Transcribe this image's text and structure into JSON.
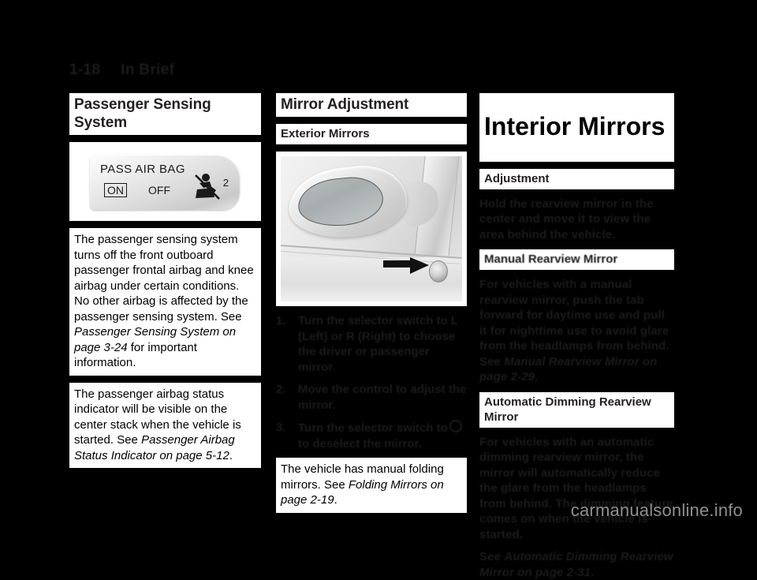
{
  "page": {
    "folio": "1-18",
    "chapter_title": "In Brief",
    "watermark": "carmanualsonline.info"
  },
  "left_column": {
    "section_title": "Passenger Sensing System",
    "figure": {
      "name": "passenger-airbag-status-indicator",
      "label_pass": "PASS AIR BAG",
      "label_on": "ON",
      "label_off": "OFF",
      "badge": "2"
    },
    "paragraph_1": "The passenger sensing system turns off the front outboard passenger frontal airbag and knee airbag under certain conditions. No other airbag is affected by the passenger sensing system. See ",
    "paragraph_1_ref": "Passenger Sensing System on page 3-24",
    "paragraph_1_tail": " for important information.",
    "paragraph_2_lead": "The passenger airbag status indicator will be visible on the center stack when the vehicle is started. See ",
    "paragraph_2_ref": "Passenger Airbag Status Indicator on page 5-12",
    "paragraph_2_tail": "."
  },
  "middle_column": {
    "section_title": "Mirror Adjustment",
    "sub_title": "Exterior Mirrors",
    "figure": {
      "name": "exterior-mirror-control-photo",
      "caption": ""
    },
    "steps": [
      {
        "number": "1.",
        "text": "Turn the selector switch to L (Left) or R (Right) to choose the driver or passenger mirror."
      },
      {
        "number": "2.",
        "text": "Move the control to adjust the mirror."
      },
      {
        "number": "3.",
        "text_before": "Turn the selector switch to",
        "symbol": "circle-icon",
        "text_after": "to deselect the mirror."
      }
    ],
    "closing_lead": "The vehicle has manual folding mirrors. See ",
    "closing_ref": "Folding Mirrors on page 2-19",
    "closing_tail": "."
  },
  "right_column": {
    "section_title": "Interior Mirrors",
    "sub_title_1": "Adjustment",
    "paragraph_1": "Hold the rearview mirror in the center and move it to view the area behind the vehicle.",
    "sub_title_2": "Manual Rearview Mirror",
    "paragraph_2_lead": "For vehicles with a manual rearview mirror, push the tab forward for daytime use and pull it for nighttime use to avoid glare from the headlamps from behind. See ",
    "paragraph_2_ref": "Manual Rearview Mirror on",
    "paragraph_2_ref2": "page 2-29",
    "paragraph_2_tail": ".",
    "sub_title_3": "Automatic Dimming Rearview Mirror",
    "paragraph_3": "For vehicles with an automatic dimming rearview mirror, the mirror will automatically reduce the glare from the headlamps from behind. The dimming feature comes on when the vehicle is started.",
    "paragraph_4_lead": "See ",
    "paragraph_4_ref": "Automatic Dimming Rearview Mirror on page 2-31",
    "paragraph_4_tail": "."
  }
}
